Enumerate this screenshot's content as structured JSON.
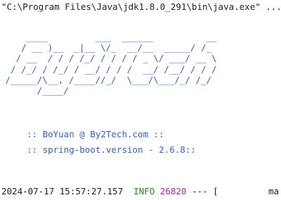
{
  "console": {
    "command": "\"C:\\Program Files\\Java\\jdk1.8.0_291\\bin\\java.exe\" ...",
    "banner_lines": [
      "     ____         ___  ______          __",
      "    / __ )__  _|__ \\/_  __/__  _____/ /_",
      "   / __  / / / /_/ / / / / _ \\/ ___/ __ \\",
      "  / /_/ / /_/ / __/ / / /  __/ /__/ / / /",
      " /_____/\\__, /____//_/  \\___/\\___/_/ /_/",
      "       /____/"
    ],
    "app_info": ":: BoYuan @ By2Tech.com ::",
    "version_info": ":: spring-boot.version - 2.6.8::",
    "log": {
      "timestamp": "2024-07-17 15:57:27.157",
      "level": "INFO",
      "pid": "26820",
      "separator": "--- [",
      "tail": "ma"
    },
    "colors": {
      "banner": "#2e62c8",
      "info_level": "#1e8a1e",
      "pid": "#a626a4",
      "text": "#1f1f1f",
      "background": "#ffffff"
    }
  }
}
